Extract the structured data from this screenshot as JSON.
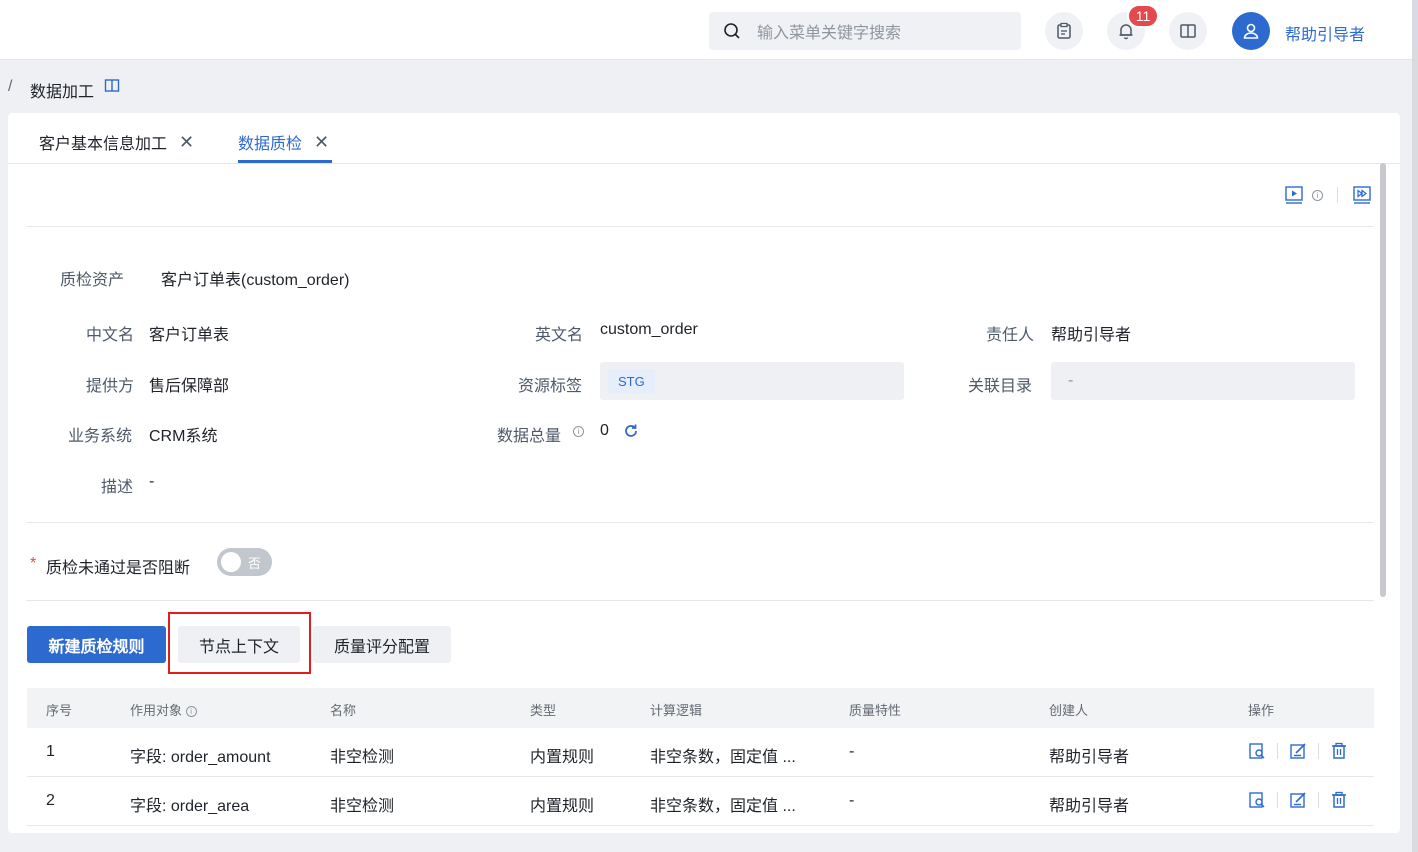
{
  "header": {
    "search_placeholder": "输入菜单关键字搜索",
    "notifications_count": "11",
    "username": "帮助引导者"
  },
  "breadcrumb": {
    "separator": "/",
    "current": "数据加工"
  },
  "tabs": [
    {
      "label": "客户基本信息加工",
      "close": "✕"
    },
    {
      "label": "数据质检",
      "close": "✕"
    }
  ],
  "info": {
    "asset_label": "质检资产",
    "asset_value": "客户订单表(custom_order)",
    "cn_name_label": "中文名",
    "cn_name_value": "客户订单表",
    "en_name_label": "英文名",
    "en_name_value": "custom_order",
    "owner_label": "责任人",
    "owner_value": "帮助引导者",
    "provider_label": "提供方",
    "provider_value": "售后保障部",
    "resource_tag_label": "资源标签",
    "resource_tag_value": "STG",
    "catalog_label": "关联目录",
    "catalog_value": "-",
    "biz_system_label": "业务系统",
    "biz_system_value": "CRM系统",
    "total_label": "数据总量",
    "total_value": "0",
    "desc_label": "描述",
    "desc_value": "-"
  },
  "block_setting": {
    "label": "质检未通过是否阻断",
    "switch_text": "否",
    "required_mark": "*"
  },
  "buttons": {
    "new_rule": "新建质检规则",
    "node_context": "节点上下文",
    "quality_score": "质量评分配置"
  },
  "table": {
    "headers": [
      "序号",
      "作用对象",
      "名称",
      "类型",
      "计算逻辑",
      "质量特性",
      "创建人",
      "操作"
    ],
    "rows": [
      [
        "1",
        "字段: order_amount",
        "非空检测",
        "内置规则",
        "非空条数，固定值 ...",
        "-",
        "帮助引导者"
      ],
      [
        "2",
        "字段: order_area",
        "非空检测",
        "内置规则",
        "非空条数，固定值 ...",
        "-",
        "帮助引导者"
      ]
    ]
  },
  "colors": {
    "accent": "#2d6ad0",
    "badge": "#e5484d",
    "highlight": "#e01e1e"
  }
}
